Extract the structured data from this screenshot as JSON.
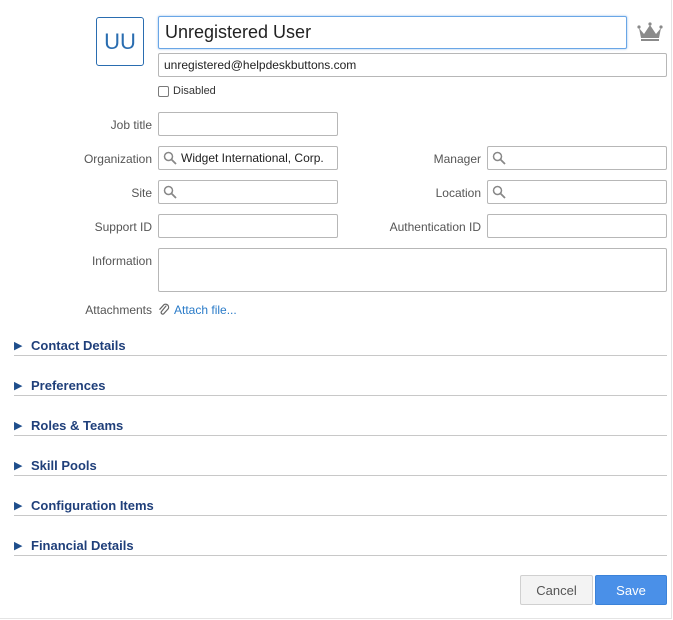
{
  "user": {
    "initials": "UU",
    "name": "Unregistered User",
    "email": "unregistered@helpdeskbuttons.com",
    "disabled_label": "Disabled",
    "disabled_checked": false
  },
  "fields": {
    "job_title_label": "Job title",
    "job_title_value": "",
    "organization_label": "Organization",
    "organization_value": "Widget International, Corp.",
    "manager_label": "Manager",
    "manager_value": "",
    "site_label": "Site",
    "site_value": "",
    "location_label": "Location",
    "location_value": "",
    "support_id_label": "Support ID",
    "support_id_value": "",
    "authentication_id_label": "Authentication ID",
    "authentication_id_value": "",
    "information_label": "Information",
    "attachments_label": "Attachments",
    "attach_file_link": "Attach file..."
  },
  "sections": [
    {
      "title": "Contact Details"
    },
    {
      "title": "Preferences"
    },
    {
      "title": "Roles & Teams"
    },
    {
      "title": "Skill Pools"
    },
    {
      "title": "Configuration Items"
    },
    {
      "title": "Financial Details"
    }
  ],
  "buttons": {
    "cancel": "Cancel",
    "save": "Save"
  },
  "icons": {
    "crown": "crown-icon",
    "search": "magnifier-icon",
    "paperclip": "paperclip-icon",
    "expand": "triangle-right-icon"
  },
  "colors": {
    "accent": "#4a90e8",
    "section_title": "#1f3f7a",
    "link": "#2a7bc8",
    "avatar": "#2a6db0"
  }
}
